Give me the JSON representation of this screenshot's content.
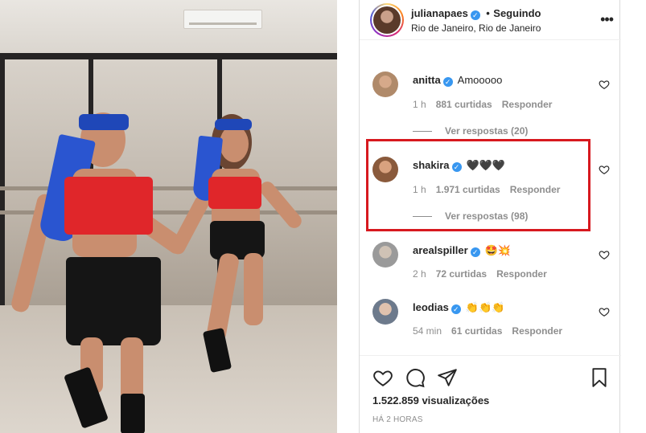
{
  "header": {
    "username": "julianapaes",
    "separator": "•",
    "follow_status": "Seguindo",
    "location": "Rio de Janeiro, Rio de Janeiro",
    "more_icon": "more-horizontal-icon"
  },
  "comments": [
    {
      "username": "anitta",
      "text": "Amooooo",
      "time": "1 h",
      "likes": "881 curtidas",
      "reply_label": "Responder",
      "view_replies": "Ver respostas (20)",
      "avatar_color": "#b08a6a"
    },
    {
      "username": "shakira",
      "text": "🖤🖤🖤",
      "time": "1 h",
      "likes": "1.971 curtidas",
      "reply_label": "Responder",
      "view_replies": "Ver respostas (98)",
      "avatar_color": "#8a5a3c"
    },
    {
      "username": "arealspiller",
      "text": "🤩💥",
      "time": "2 h",
      "likes": "72 curtidas",
      "reply_label": "Responder",
      "avatar_color": "#9a9a9a"
    },
    {
      "username": "leodias",
      "text": "👏👏👏",
      "time": "54 min",
      "likes": "61 curtidas",
      "reply_label": "Responder",
      "avatar_color": "#6d7a8c"
    }
  ],
  "actions": {
    "views": "1.522.859 visualizações",
    "time_ago": "HÁ 2 HORAS"
  },
  "colors": {
    "verified": "#3897f0",
    "highlight": "#d7191f",
    "meta_text": "#8e8e8e"
  }
}
